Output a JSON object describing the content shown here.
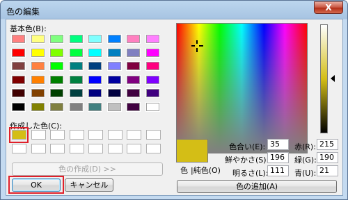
{
  "window": {
    "title": "色の編集",
    "close_label": "X"
  },
  "basic": {
    "label": "基本色(B):",
    "colors": [
      [
        "#ff8080",
        "#ffff80",
        "#80ff80",
        "#00ff80",
        "#80ffff",
        "#0080ff",
        "#ff80c0",
        "#ff80ff"
      ],
      [
        "#ff0000",
        "#ffff00",
        "#80ff00",
        "#00ff40",
        "#00ffff",
        "#0080c0",
        "#8080c0",
        "#ff00ff"
      ],
      [
        "#804040",
        "#ff8040",
        "#00ff00",
        "#008080",
        "#004080",
        "#8080ff",
        "#800040",
        "#ff0080"
      ],
      [
        "#800000",
        "#ff8000",
        "#008000",
        "#008040",
        "#0000ff",
        "#0000a0",
        "#800080",
        "#8000ff"
      ],
      [
        "#400000",
        "#804000",
        "#004000",
        "#004040",
        "#000080",
        "#000040",
        "#400040",
        "#400080"
      ],
      [
        "#000000",
        "#808000",
        "#808040",
        "#808080",
        "#408080",
        "#c0c0c0",
        "#400040",
        "#ffffff"
      ]
    ]
  },
  "custom": {
    "label": "作成した色(C):",
    "first_color": "#d4be16"
  },
  "buttons": {
    "define_label": "色の作成(D) >>",
    "ok_label": "OK",
    "cancel_label": "キャンセル",
    "add_label": "色の追加(A)"
  },
  "preview": {
    "color": "#d4be16",
    "color_label": "色",
    "solid_label": "|純色(O)"
  },
  "fields": {
    "hue_label": "色合い(E):",
    "hue": "35",
    "sat_label": "鮮やかさ(S):",
    "sat": "196",
    "lum_label": "明るさ(L):",
    "lum": "111",
    "red_label": "赤(R):",
    "red": "215",
    "green_label": "緑(G):",
    "green": "190",
    "blue_label": "青(U):",
    "blue": "21"
  }
}
